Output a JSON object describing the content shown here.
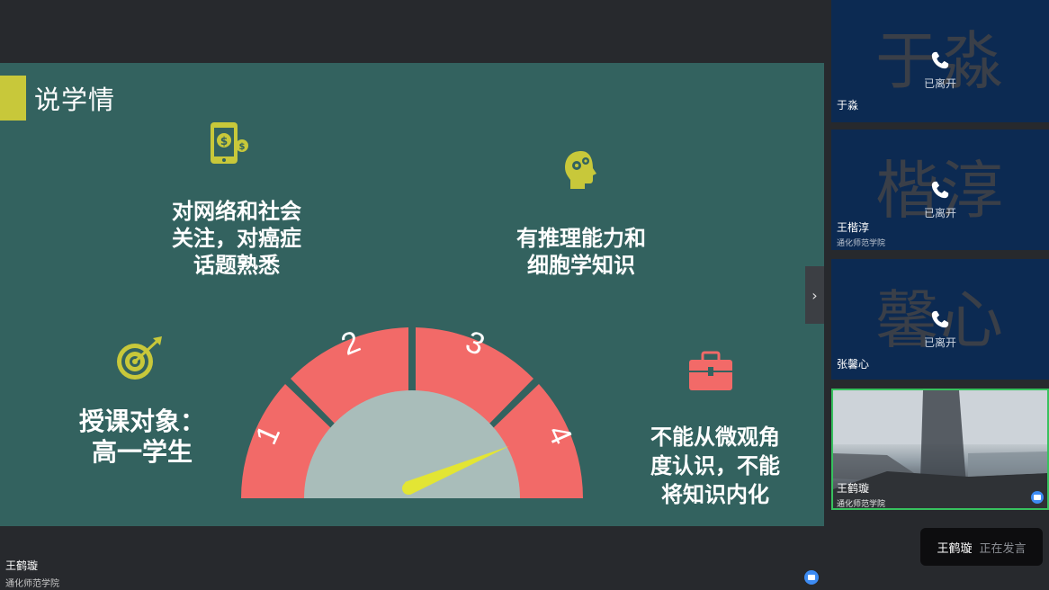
{
  "slide": {
    "title": "说学情",
    "blurb_network": [
      "对网络和社会",
      "关注，对癌症",
      "话题熟悉"
    ],
    "blurb_reasoning": [
      "有推理能力和",
      "细胞学知识"
    ],
    "blurb_audience": [
      "授课对象：",
      "高一学生"
    ],
    "blurb_weakness": [
      "不能从微观角",
      "度认识，不能",
      "将知识内化"
    ],
    "gauge_segments": [
      "1",
      "2",
      "3",
      "4"
    ],
    "colors": {
      "background": "#33625f",
      "accent": "#c8c83a",
      "gauge": "#f26a68",
      "dial": "#a9bdba",
      "needle": "#e3e534"
    },
    "icons": [
      "phone-money-icon",
      "brain-gear-icon",
      "target-icon",
      "briefcase-icon"
    ]
  },
  "presenter": {
    "name": "王鹤璇",
    "org": "通化师范学院"
  },
  "participants": [
    {
      "watermark": "于淼",
      "status": "已离开",
      "name": "于淼",
      "org": ""
    },
    {
      "watermark": "楷淳",
      "status": "已离开",
      "name": "王楷淳",
      "org": "通化师范学院"
    },
    {
      "watermark": "馨心",
      "status": "已离开",
      "name": "张馨心",
      "org": ""
    }
  ],
  "video_participant": {
    "name": "王鹤璇",
    "org": "通化师范学院"
  },
  "speaking_toast": {
    "name": "王鹤璇",
    "label": "正在发言"
  }
}
